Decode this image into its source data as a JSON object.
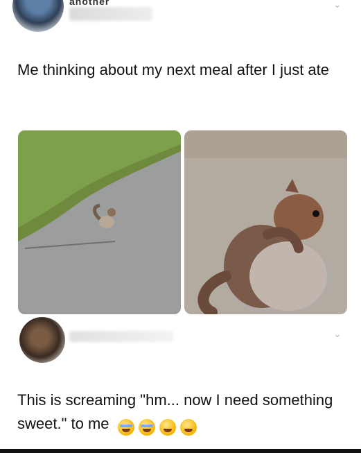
{
  "post1": {
    "author_fragment": "another",
    "text": "Me thinking about my next meal after I just ate",
    "images": [
      "squirrel-on-path-photo",
      "fat-squirrel-closeup-photo"
    ]
  },
  "post2": {
    "text": "This is screaming \"hm... now I need something sweet.\" to me",
    "emojis": [
      "crying-laughing-face",
      "crying-laughing-face",
      "grinning-squinting-face",
      "grinning-squinting-face"
    ]
  },
  "ui": {
    "chevron_icon": "chevron-down-icon"
  }
}
